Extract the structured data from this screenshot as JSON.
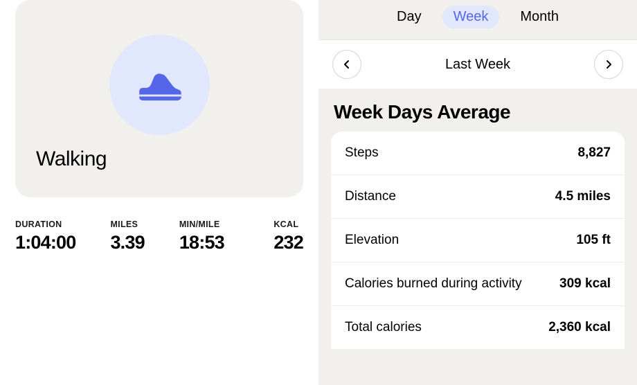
{
  "activity": {
    "name": "Walking",
    "metrics": [
      {
        "label": "DURATION",
        "value": "1:04:00"
      },
      {
        "label": "MILES",
        "value": "3.39"
      },
      {
        "label": "MIN/MILE",
        "value": "18:53"
      },
      {
        "label": "KCAL",
        "value": "232"
      }
    ]
  },
  "period": {
    "tabs": [
      {
        "label": "Day",
        "active": false
      },
      {
        "label": "Week",
        "active": true
      },
      {
        "label": "Month",
        "active": false
      }
    ],
    "current": "Last Week"
  },
  "summary": {
    "title": "Week Days Average",
    "rows": [
      {
        "label": "Steps",
        "value": "8,827"
      },
      {
        "label": "Distance",
        "value": "4.5 miles"
      },
      {
        "label": "Elevation",
        "value": "105 ft"
      },
      {
        "label": "Calories burned during activity",
        "value": "309 kcal"
      },
      {
        "label": "Total calories",
        "value": "2,360 kcal"
      }
    ]
  }
}
